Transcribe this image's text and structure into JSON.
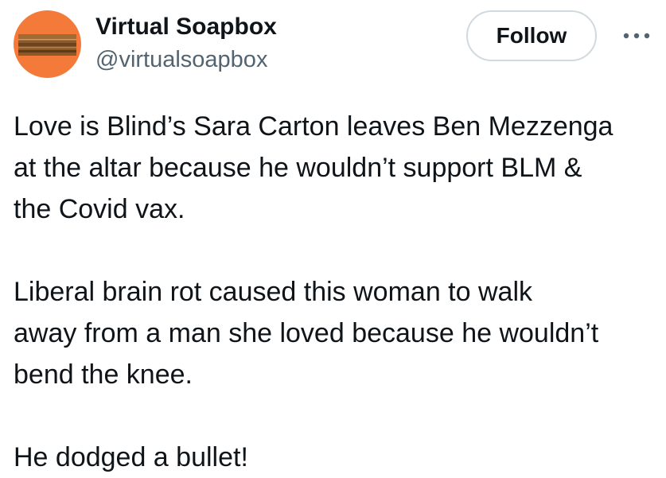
{
  "author": {
    "display_name": "Virtual Soapbox",
    "handle": "@virtualsoapbox",
    "avatar_icon": "soapbox-crate-icon",
    "avatar_bg": "#f47a3a"
  },
  "actions": {
    "follow_label": "Follow",
    "more_icon": "more-dots-icon"
  },
  "tweet": {
    "paragraphs": [
      "Love is Blind’s Sara Carton leaves Ben Mezzenga\nat the altar because he wouldn’t support BLM &\nthe Covid vax.",
      "Liberal brain rot caused this woman to walk\naway from a man she loved because he wouldn’t\nbend the knee.",
      "He dodged a bullet!"
    ]
  },
  "colors": {
    "text_primary": "#0f1419",
    "text_secondary": "#536471",
    "button_border": "#cfd9de"
  }
}
